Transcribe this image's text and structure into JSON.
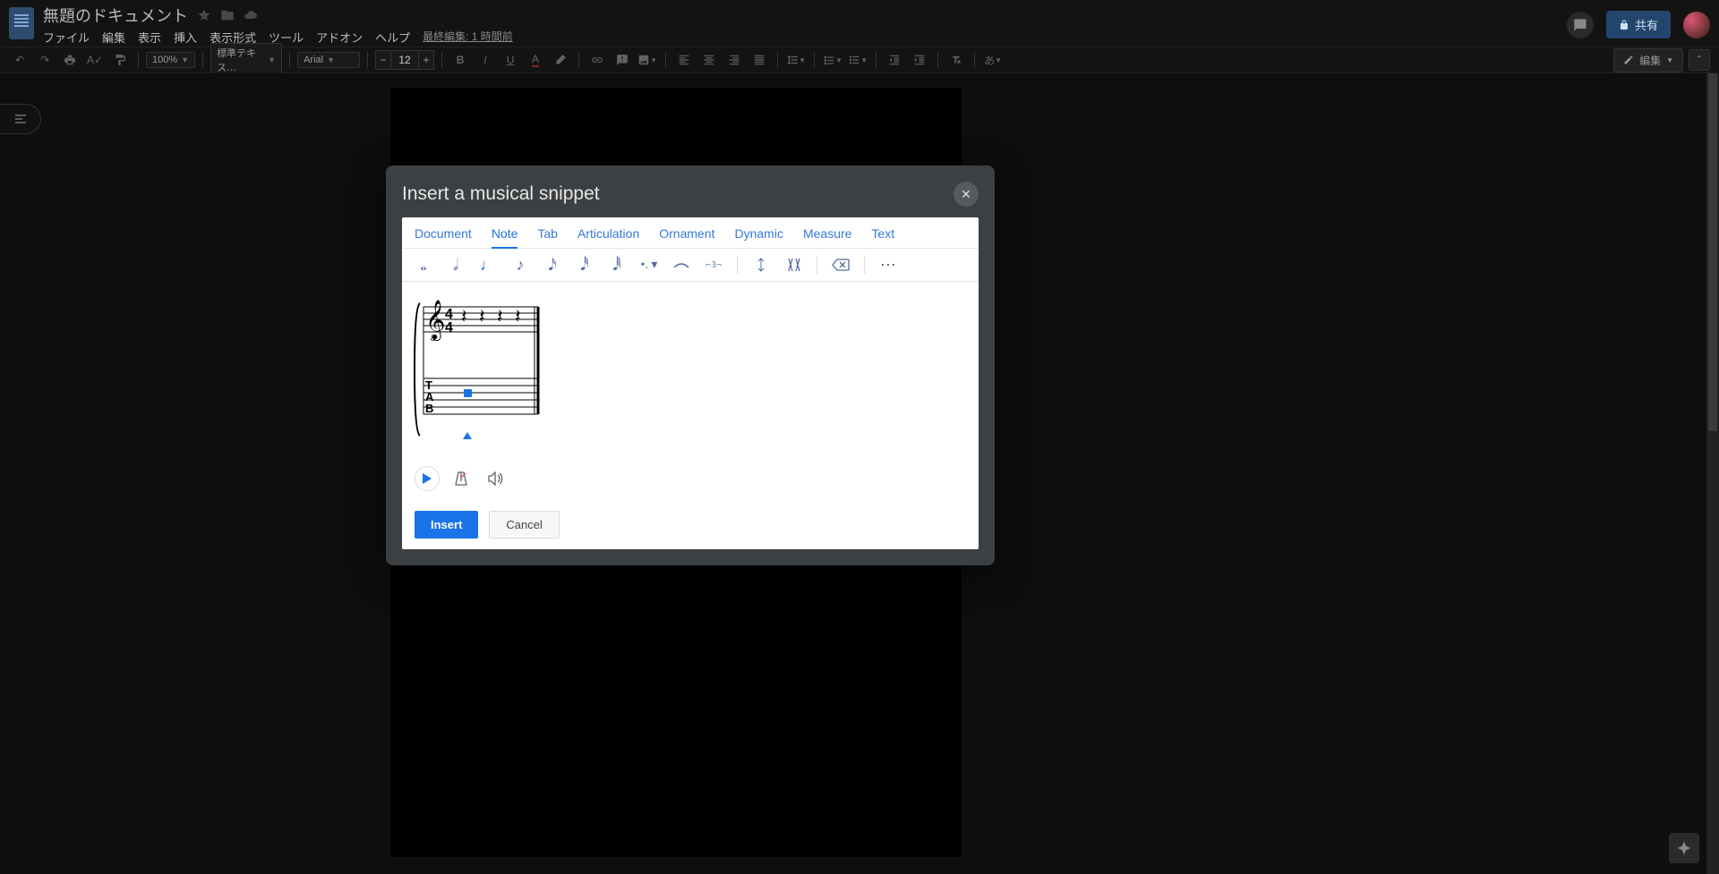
{
  "app": {
    "title": "無題のドキュメント",
    "last_edit": "最終編集: 1 時間前",
    "share_label": "共有"
  },
  "menus": [
    "ファイル",
    "編集",
    "表示",
    "挿入",
    "表示形式",
    "ツール",
    "アドオン",
    "ヘルプ"
  ],
  "toolbar": {
    "zoom": "100%",
    "style": "標準テキス…",
    "font": "Arial",
    "font_size": "12",
    "mode": "編集"
  },
  "dialog": {
    "title": "Insert a musical snippet",
    "tabs": [
      "Document",
      "Note",
      "Tab",
      "Articulation",
      "Ornament",
      "Dynamic",
      "Measure",
      "Text"
    ],
    "active_tab": 1,
    "insert_label": "Insert",
    "cancel_label": "Cancel"
  },
  "notation_tools": [
    "whole",
    "half",
    "quarter",
    "eighth",
    "sixteenth",
    "thirtysecond",
    "sixtyfourth",
    "dot",
    "tie",
    "tuplet",
    "voice1",
    "voice2",
    "backspace",
    "more"
  ],
  "score": {
    "clef": "treble-8vb",
    "time_signature": "4/4",
    "tab_label": "TAB",
    "tab_strings": 6,
    "selected_beat": 1
  }
}
